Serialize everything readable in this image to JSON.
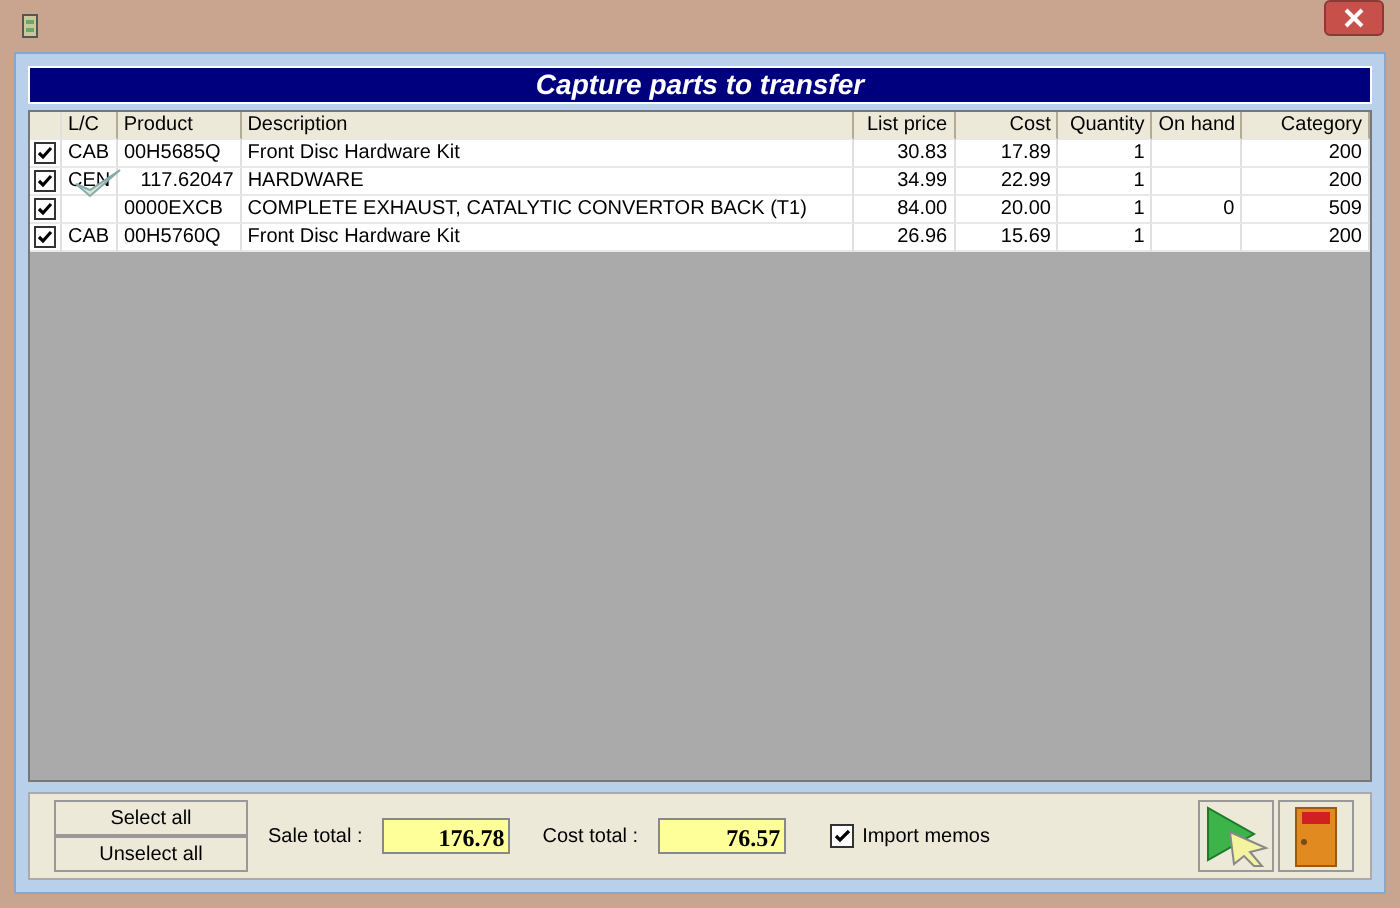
{
  "header": {
    "title": "Capture parts to transfer"
  },
  "table": {
    "columns": [
      "L/C",
      "Product",
      "Description",
      "List price",
      "Cost",
      "Quantity",
      "On hand",
      "Category"
    ],
    "rows": [
      {
        "checked": true,
        "cells": [
          "CAB",
          "00H5685Q",
          "Front Disc Hardware Kit",
          "30.83",
          "17.89",
          "1",
          "",
          "200"
        ]
      },
      {
        "checked": true,
        "cells": [
          "CEN",
          "117.62047",
          "HARDWARE",
          "34.99",
          "22.99",
          "1",
          "",
          "200"
        ]
      },
      {
        "checked": true,
        "cells": [
          "",
          "0000EXCB",
          "COMPLETE EXHAUST, CATALYTIC CONVERTOR BACK (T1)",
          "84.00",
          "20.00",
          "1",
          "0",
          "509"
        ]
      },
      {
        "checked": true,
        "cells": [
          "CAB",
          "00H5760Q",
          "Front Disc Hardware Kit",
          "26.96",
          "15.69",
          "1",
          "",
          "200"
        ]
      }
    ]
  },
  "footer": {
    "select_all": "Select all",
    "unselect_all": "Unselect all",
    "sale_total_label": "Sale total :",
    "sale_total": "176.78",
    "cost_total_label": "Cost total :",
    "cost_total": "76.57",
    "import_memos": {
      "label": "Import memos",
      "checked": true
    }
  }
}
